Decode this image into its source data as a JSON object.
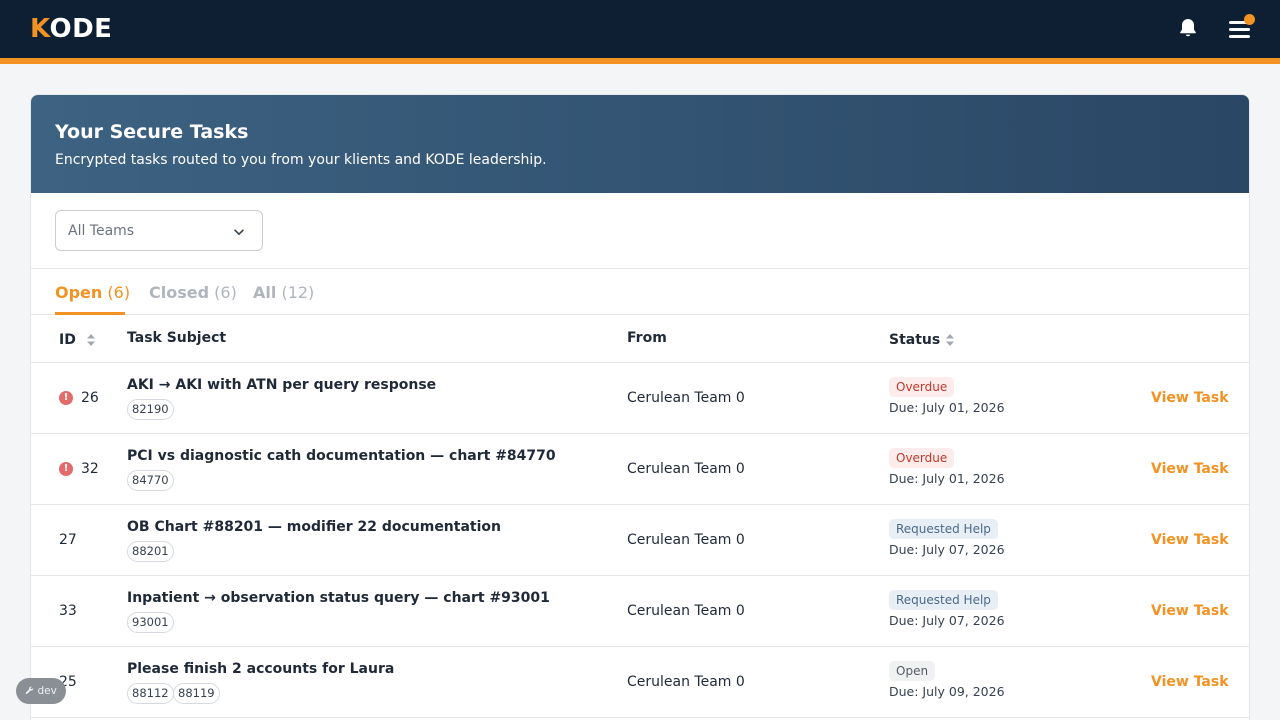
{
  "brand": {
    "logo_k": "K",
    "logo_rest": "ODE",
    "accent": "#f29222",
    "navy": "#0f1f33"
  },
  "header": {
    "icons": [
      "bell-icon",
      "menu-icon",
      "notification-dot"
    ]
  },
  "hero": {
    "title": "Your Secure Tasks",
    "subtitle": "Encrypted tasks routed to you from your klients and KODE leadership."
  },
  "filter": {
    "selected": "All Teams",
    "icon": "chevron-down-icon"
  },
  "tabs": [
    {
      "name": "Open",
      "count": "(6)",
      "active": true
    },
    {
      "name": "Closed",
      "count": "(6)",
      "active": false
    },
    {
      "name": "All",
      "count": "(12)",
      "active": false
    }
  ],
  "table": {
    "columns": {
      "id": "ID",
      "subject": "Task Subject",
      "from": "From",
      "status": "Status"
    },
    "rows": [
      {
        "id": "26",
        "overdue_alert": true,
        "subject": "AKI → AKI with ATN per query response",
        "tags": [
          "82190"
        ],
        "from": "Cerulean Team 0",
        "status": "Overdue",
        "due": "Due: July 01, 2026",
        "action": "View Task"
      },
      {
        "id": "32",
        "overdue_alert": true,
        "subject": "PCI vs diagnostic cath documentation — chart #84770",
        "tags": [
          "84770"
        ],
        "from": "Cerulean Team 0",
        "status": "Overdue",
        "due": "Due: July 01, 2026",
        "action": "View Task"
      },
      {
        "id": "27",
        "overdue_alert": false,
        "subject": "OB Chart #88201 — modifier 22 documentation",
        "tags": [
          "88201"
        ],
        "from": "Cerulean Team 0",
        "status": "Requested Help",
        "due": "Due: July 07, 2026",
        "action": "View Task"
      },
      {
        "id": "33",
        "overdue_alert": false,
        "subject": "Inpatient → observation status query — chart #93001",
        "tags": [
          "93001"
        ],
        "from": "Cerulean Team 0",
        "status": "Requested Help",
        "due": "Due: July 07, 2026",
        "action": "View Task"
      },
      {
        "id": "25",
        "overdue_alert": false,
        "subject": "Please finish 2 accounts for Laura",
        "tags": [
          "88112",
          "88119"
        ],
        "from": "Cerulean Team 0",
        "status": "Open",
        "due": "Due: July 09, 2026",
        "action": "View Task"
      }
    ]
  },
  "dev_badge": {
    "label": "dev",
    "icon": "wrench-icon"
  }
}
